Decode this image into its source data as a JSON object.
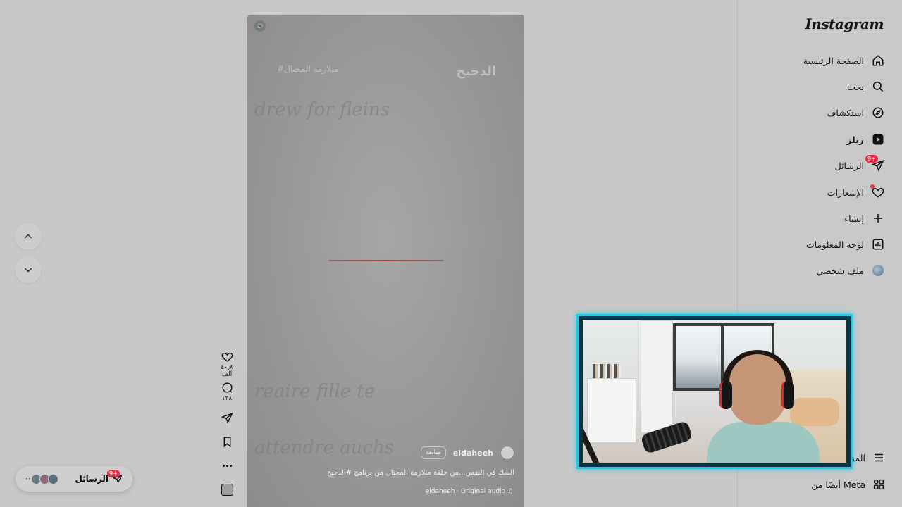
{
  "app": {
    "logo": "Instagram"
  },
  "sidebar": {
    "items": [
      {
        "label": "الصفحة الرئيسية",
        "icon": "home-icon"
      },
      {
        "label": "بحث",
        "icon": "search-icon"
      },
      {
        "label": "استكشاف",
        "icon": "compass-icon"
      },
      {
        "label": "ريلز",
        "icon": "reels-icon",
        "active": true
      },
      {
        "label": "الرسائل",
        "icon": "messenger-icon",
        "badge": "9+"
      },
      {
        "label": "الإشعارات",
        "icon": "heart-icon"
      },
      {
        "label": "إنشاء",
        "icon": "plus-icon"
      },
      {
        "label": "لوحة المعلومات",
        "icon": "dashboard-icon"
      },
      {
        "label": "ملف شخصي",
        "icon": "profile-avatar"
      }
    ],
    "more_label": "المزيد",
    "meta_label": "أيضًا من Meta"
  },
  "reel": {
    "watermark_brand": "الدحيح",
    "watermark_tag": "#متلازمة المحتال",
    "username": "eldaheeh",
    "follow_label": "متابعة",
    "caption": "الشك في النفس...من حلقة متلازمة المحتال من برنامج #الدحيح",
    "audio": "eldaheeh · Original audio"
  },
  "actions": {
    "likes": "٤٠٫٨ ألف",
    "comments": "١٣٨"
  },
  "messages_pill": {
    "label": "الرسائل",
    "badge": "9+"
  },
  "colors": {
    "accent": "#e0334a",
    "cam_border": "#27c6e6"
  }
}
